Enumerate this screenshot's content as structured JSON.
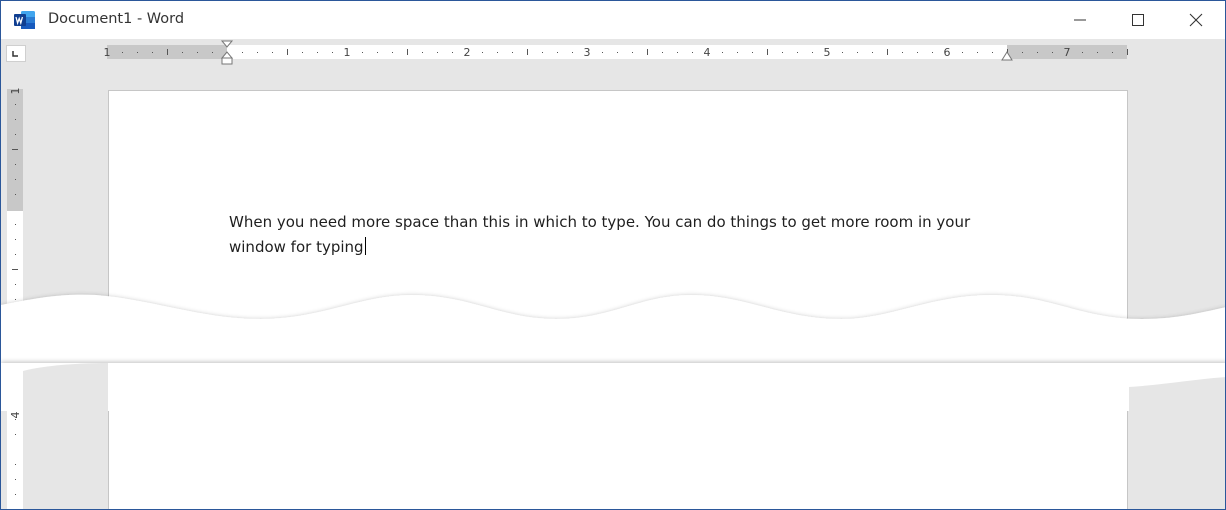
{
  "window": {
    "title": "Document1 - Word",
    "app_icon": "word-app-icon",
    "controls": {
      "minimize": "minimize-icon",
      "maximize": "maximize-icon",
      "close": "close-icon"
    }
  },
  "ruler": {
    "horizontal_numbers": [
      "1",
      "1",
      "2",
      "3",
      "4",
      "5",
      "6",
      "7"
    ],
    "vertical_numbers": [
      "1",
      "4"
    ]
  },
  "document": {
    "line1": "When you need more space than this in which to type. You can do things to get more room in your",
    "line2": "window for typing"
  },
  "colors": {
    "accent": "#2b579a",
    "workspace": "#e6e6e6",
    "margin_shade": "#c8c8c8"
  }
}
